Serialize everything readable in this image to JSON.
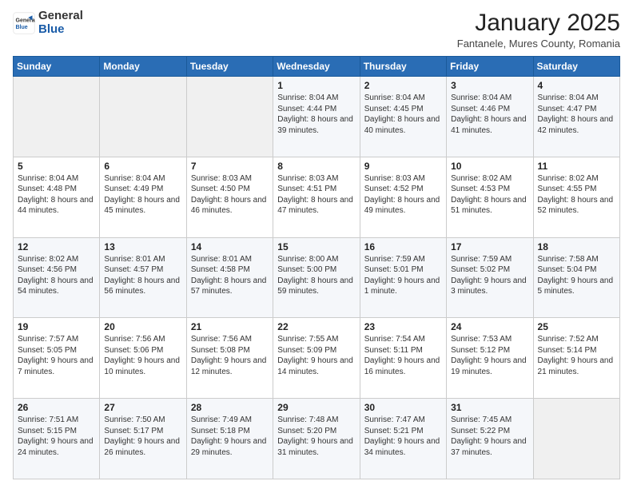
{
  "header": {
    "logo_general": "General",
    "logo_blue": "Blue",
    "month": "January 2025",
    "location": "Fantanele, Mures County, Romania"
  },
  "weekdays": [
    "Sunday",
    "Monday",
    "Tuesday",
    "Wednesday",
    "Thursday",
    "Friday",
    "Saturday"
  ],
  "weeks": [
    [
      {
        "day": "",
        "info": ""
      },
      {
        "day": "",
        "info": ""
      },
      {
        "day": "",
        "info": ""
      },
      {
        "day": "1",
        "info": "Sunrise: 8:04 AM\nSunset: 4:44 PM\nDaylight: 8 hours and 39 minutes."
      },
      {
        "day": "2",
        "info": "Sunrise: 8:04 AM\nSunset: 4:45 PM\nDaylight: 8 hours and 40 minutes."
      },
      {
        "day": "3",
        "info": "Sunrise: 8:04 AM\nSunset: 4:46 PM\nDaylight: 8 hours and 41 minutes."
      },
      {
        "day": "4",
        "info": "Sunrise: 8:04 AM\nSunset: 4:47 PM\nDaylight: 8 hours and 42 minutes."
      }
    ],
    [
      {
        "day": "5",
        "info": "Sunrise: 8:04 AM\nSunset: 4:48 PM\nDaylight: 8 hours and 44 minutes."
      },
      {
        "day": "6",
        "info": "Sunrise: 8:04 AM\nSunset: 4:49 PM\nDaylight: 8 hours and 45 minutes."
      },
      {
        "day": "7",
        "info": "Sunrise: 8:03 AM\nSunset: 4:50 PM\nDaylight: 8 hours and 46 minutes."
      },
      {
        "day": "8",
        "info": "Sunrise: 8:03 AM\nSunset: 4:51 PM\nDaylight: 8 hours and 47 minutes."
      },
      {
        "day": "9",
        "info": "Sunrise: 8:03 AM\nSunset: 4:52 PM\nDaylight: 8 hours and 49 minutes."
      },
      {
        "day": "10",
        "info": "Sunrise: 8:02 AM\nSunset: 4:53 PM\nDaylight: 8 hours and 51 minutes."
      },
      {
        "day": "11",
        "info": "Sunrise: 8:02 AM\nSunset: 4:55 PM\nDaylight: 8 hours and 52 minutes."
      }
    ],
    [
      {
        "day": "12",
        "info": "Sunrise: 8:02 AM\nSunset: 4:56 PM\nDaylight: 8 hours and 54 minutes."
      },
      {
        "day": "13",
        "info": "Sunrise: 8:01 AM\nSunset: 4:57 PM\nDaylight: 8 hours and 56 minutes."
      },
      {
        "day": "14",
        "info": "Sunrise: 8:01 AM\nSunset: 4:58 PM\nDaylight: 8 hours and 57 minutes."
      },
      {
        "day": "15",
        "info": "Sunrise: 8:00 AM\nSunset: 5:00 PM\nDaylight: 8 hours and 59 minutes."
      },
      {
        "day": "16",
        "info": "Sunrise: 7:59 AM\nSunset: 5:01 PM\nDaylight: 9 hours and 1 minute."
      },
      {
        "day": "17",
        "info": "Sunrise: 7:59 AM\nSunset: 5:02 PM\nDaylight: 9 hours and 3 minutes."
      },
      {
        "day": "18",
        "info": "Sunrise: 7:58 AM\nSunset: 5:04 PM\nDaylight: 9 hours and 5 minutes."
      }
    ],
    [
      {
        "day": "19",
        "info": "Sunrise: 7:57 AM\nSunset: 5:05 PM\nDaylight: 9 hours and 7 minutes."
      },
      {
        "day": "20",
        "info": "Sunrise: 7:56 AM\nSunset: 5:06 PM\nDaylight: 9 hours and 10 minutes."
      },
      {
        "day": "21",
        "info": "Sunrise: 7:56 AM\nSunset: 5:08 PM\nDaylight: 9 hours and 12 minutes."
      },
      {
        "day": "22",
        "info": "Sunrise: 7:55 AM\nSunset: 5:09 PM\nDaylight: 9 hours and 14 minutes."
      },
      {
        "day": "23",
        "info": "Sunrise: 7:54 AM\nSunset: 5:11 PM\nDaylight: 9 hours and 16 minutes."
      },
      {
        "day": "24",
        "info": "Sunrise: 7:53 AM\nSunset: 5:12 PM\nDaylight: 9 hours and 19 minutes."
      },
      {
        "day": "25",
        "info": "Sunrise: 7:52 AM\nSunset: 5:14 PM\nDaylight: 9 hours and 21 minutes."
      }
    ],
    [
      {
        "day": "26",
        "info": "Sunrise: 7:51 AM\nSunset: 5:15 PM\nDaylight: 9 hours and 24 minutes."
      },
      {
        "day": "27",
        "info": "Sunrise: 7:50 AM\nSunset: 5:17 PM\nDaylight: 9 hours and 26 minutes."
      },
      {
        "day": "28",
        "info": "Sunrise: 7:49 AM\nSunset: 5:18 PM\nDaylight: 9 hours and 29 minutes."
      },
      {
        "day": "29",
        "info": "Sunrise: 7:48 AM\nSunset: 5:20 PM\nDaylight: 9 hours and 31 minutes."
      },
      {
        "day": "30",
        "info": "Sunrise: 7:47 AM\nSunset: 5:21 PM\nDaylight: 9 hours and 34 minutes."
      },
      {
        "day": "31",
        "info": "Sunrise: 7:45 AM\nSunset: 5:22 PM\nDaylight: 9 hours and 37 minutes."
      },
      {
        "day": "",
        "info": ""
      }
    ]
  ]
}
